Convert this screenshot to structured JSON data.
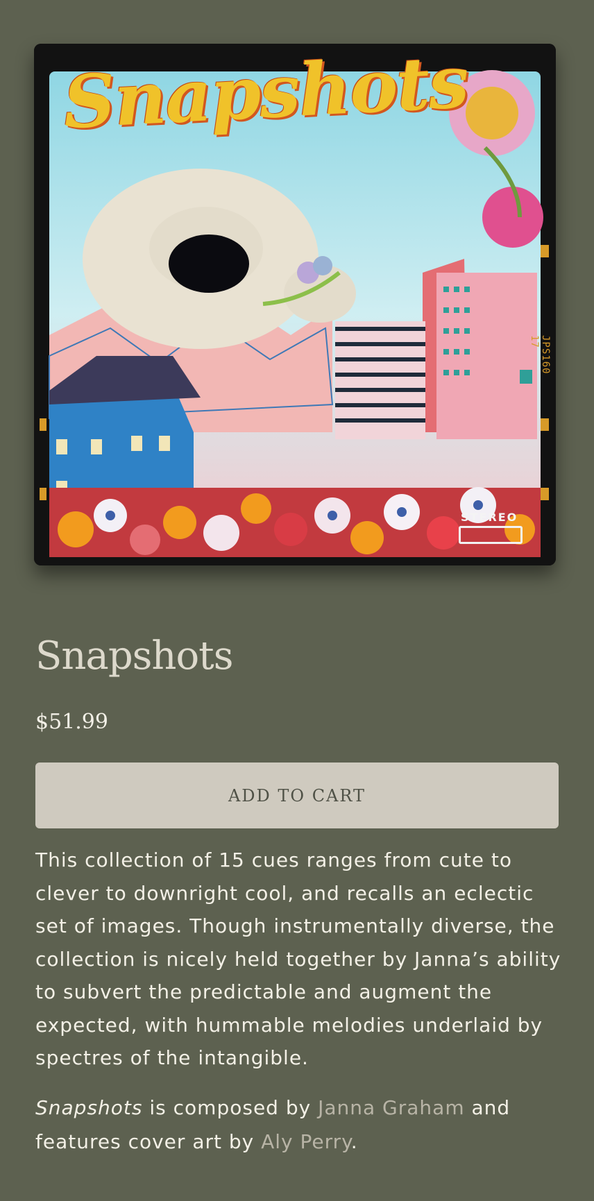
{
  "album": {
    "cover_title": "Snapshots",
    "stereo_badge": "STEREO",
    "film_code": "JPS160 17"
  },
  "product": {
    "title": "Snapshots",
    "price": "$51.99",
    "add_to_cart_label": "ADD TO CART"
  },
  "description": "This collection of 15 cues ranges from cute to clever to downright cool, and recalls an eclectic set of images. Though instrumentally diverse, the collection is nicely held together by Janna’s ability to subvert the predictable and augment the expected, with hummable melodies underlaid by spectres of the intangible.",
  "credits": {
    "title_italic": "Snapshots",
    "composed_by_text": " is composed by ",
    "composer_link": "Janna Graham",
    "and_text": " and features cover art by ",
    "artist_link": "Aly Perry",
    "end_punct": "."
  },
  "colors": {
    "background": "#5d6150",
    "button_bg": "#cfcabf",
    "link": "#b8b4a6",
    "cover_title": "#f0c22a"
  }
}
